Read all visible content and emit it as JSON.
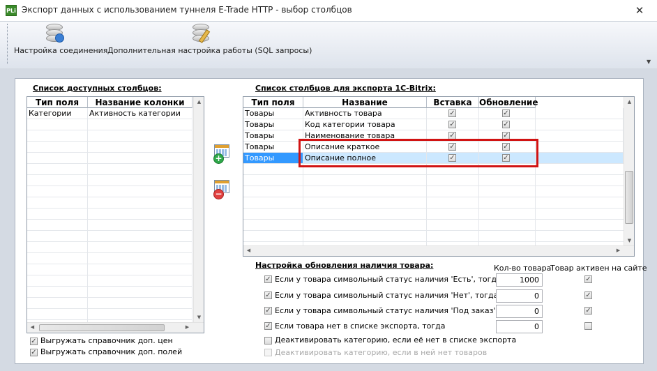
{
  "window": {
    "app_icon": "PLi",
    "title": "Экспорт данных с использованием туннеля E-Trade HTTP - выбор столбцов",
    "close": "✕"
  },
  "toolbar": {
    "buttons": [
      {
        "label": "Настройка соединения",
        "icon": "database-settings-icon"
      },
      {
        "label": "Дополнительная настройка работы (SQL запросы)",
        "icon": "database-edit-icon"
      }
    ]
  },
  "available": {
    "title": "Список доступных столбцов:",
    "columns": [
      "Тип поля",
      "Название колонки"
    ],
    "rows": [
      [
        "Категории",
        "Активность категории"
      ]
    ]
  },
  "export": {
    "title": "Список столбцов для экспорта 1С-Bitrix:",
    "columns": [
      "Тип поля",
      "Название",
      "Вставка",
      "Обновление"
    ],
    "rows": [
      {
        "type": "Товары",
        "name": "Активность товара",
        "insert": true,
        "update": true
      },
      {
        "type": "Товары",
        "name": "Код категории товара",
        "insert": true,
        "update": true
      },
      {
        "type": "Товары",
        "name": "Наименование товара",
        "insert": true,
        "update": true
      },
      {
        "type": "Товары",
        "name": "Описание краткое",
        "insert": true,
        "update": true
      },
      {
        "type": "Товары",
        "name": "Описание полное",
        "insert": true,
        "update": true
      }
    ],
    "selected_row": 5
  },
  "availability": {
    "title": "Настройка обновления наличия товара:",
    "qty_header": "Кол-во товара",
    "active_header": "Товар активен на сайте",
    "rules": [
      {
        "label": "Если у товара символьный статус наличия 'Есть', тогда",
        "checked": true,
        "qty": "1000",
        "active": true
      },
      {
        "label": "Если у товара символьный статус наличия 'Нет', тогда",
        "checked": true,
        "qty": "0",
        "active": true
      },
      {
        "label": "Если у товара символьный статус наличия 'Под заказ', тогда",
        "checked": true,
        "qty": "0",
        "active": true
      },
      {
        "label": "Если товара нет в списке экспорта, тогда",
        "checked": true,
        "qty": "0",
        "active": false
      }
    ],
    "deactivate_category_missing": {
      "label": "Деактивировать категорию, если её нет в списке экспорта",
      "checked": false
    },
    "deactivate_category_empty": {
      "label": "Деактивировать категорию, если в ней нет товаров",
      "checked": false
    }
  },
  "bottom_options": [
    {
      "label": "Выгружать справочник доп. цен",
      "checked": true
    },
    {
      "label": "Выгружать справочник доп. полей",
      "checked": true
    }
  ],
  "colors": {
    "highlight": "#d11313",
    "selection": "#3399ff",
    "frame": "#d4dae3"
  }
}
